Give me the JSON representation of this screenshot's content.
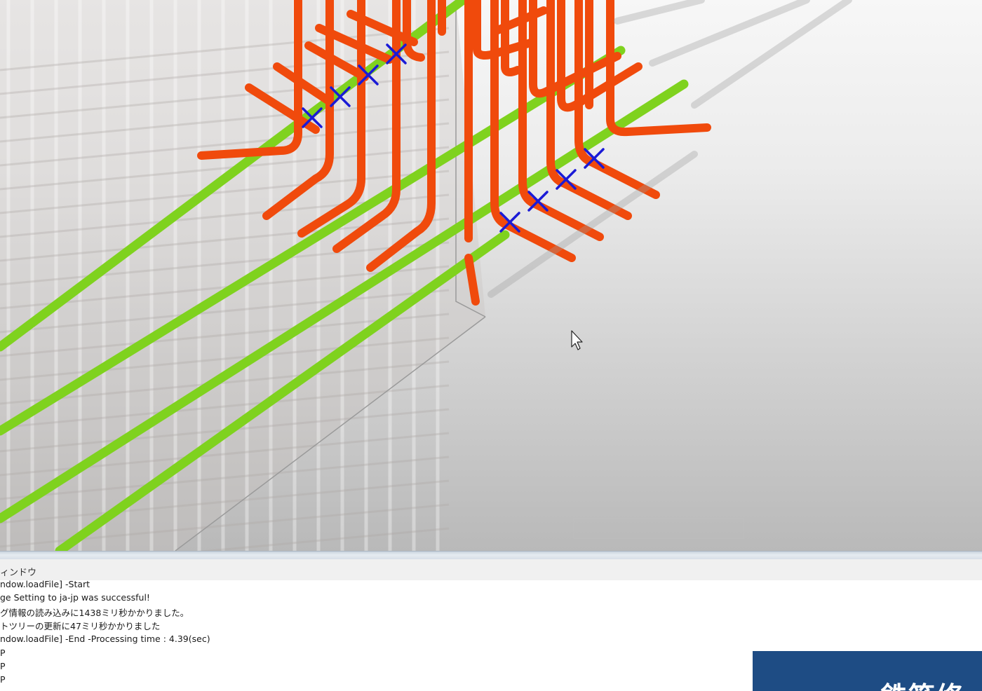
{
  "viewport": {
    "name": "3D model view",
    "colors": {
      "main_bar": "#7fd21e",
      "stirrup_bar": "#f04a0c",
      "marker": "#1a1ad6",
      "frame": "#b3b3b3"
    },
    "cursor_icon": "arrow-cursor-icon"
  },
  "output_panel": {
    "title": "ィンドウ",
    "lines": [
      "ndow.loadFile] -Start",
      "ge Setting to ja-jp was successful!",
      "グ情報の読み込みに1438ミリ秒かかりました。",
      "トツリーの更新に47ミリ秒かかりました",
      "ndow.loadFile] -End -Processing time : 4.39(sec)",
      "P",
      "P",
      "P"
    ]
  },
  "banner": {
    "text": "鉄筋修",
    "color": "#1e4c84"
  }
}
